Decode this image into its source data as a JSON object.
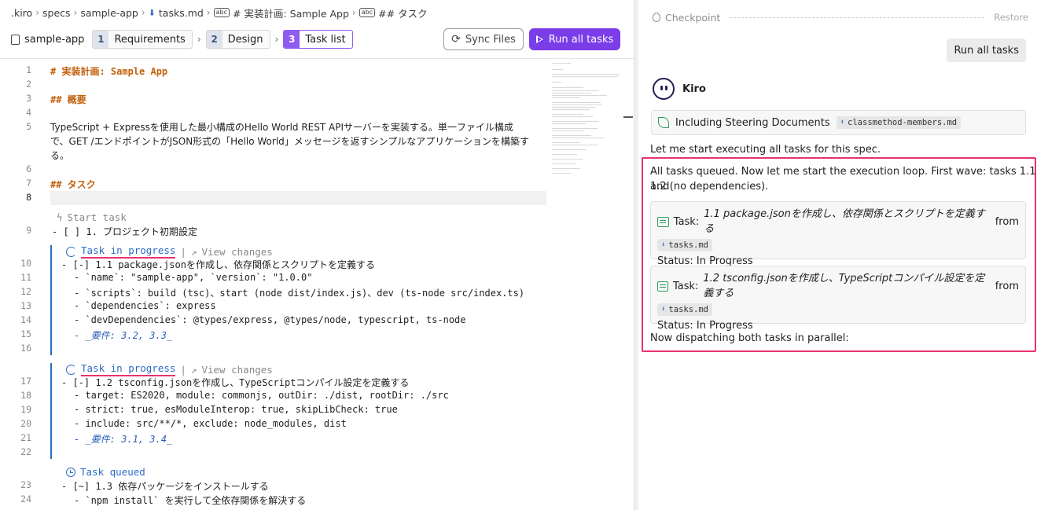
{
  "breadcrumb": {
    "items": [
      ".kiro",
      "specs",
      "sample-app",
      "tasks.md",
      "# 実装計画: Sample App",
      "## タスク"
    ]
  },
  "specbar": {
    "root": "sample-app",
    "steps": [
      {
        "num": "1",
        "label": "Requirements"
      },
      {
        "num": "2",
        "label": "Design"
      },
      {
        "num": "3",
        "label": "Task list"
      }
    ],
    "sync_label": "Sync Files",
    "run_label": "Run all tasks"
  },
  "editor": {
    "line_numbers": [
      "1",
      "2",
      "3",
      "4",
      "5",
      "6",
      "7",
      "8",
      "9",
      "10",
      "11",
      "12",
      "13",
      "14",
      "15",
      "16",
      "17",
      "18",
      "19",
      "20",
      "21",
      "22",
      "23",
      "24"
    ],
    "l1": "# 実装計画: Sample App",
    "l3": "## 概要",
    "l5a": "TypeScript + Expressを使用した最小構成のHello World REST APIサーバーを実装する。単一ファイル構成",
    "l5b": "で、GET /エンドポイントがJSON形式の「Hello World」メッセージを返すシンプルなアプリケーションを構築す",
    "l5c": "る。",
    "l7": "## タスク",
    "lens_start": "Start task",
    "l9": "- [ ] 1. プロジェクト初期設定",
    "lens1_status": "Task in progress",
    "lens1_changes": "View changes",
    "l10": "- [-] 1.1 package.jsonを作成し、依存関係とスクリプトを定義する",
    "l11": "- `name`: \"sample-app\", `version`: \"1.0.0\"",
    "l12": "- `scripts`: build (tsc)、start (node dist/index.js)、dev (ts-node src/index.ts)",
    "l13": "- `dependencies`: express",
    "l14": "- `devDependencies`: @types/express, @types/node, typescript, ts-node",
    "l15": "- _要件: 3.2, 3.3_",
    "lens2_status": "Task in progress",
    "lens2_changes": "View changes",
    "l17": "- [-] 1.2 tsconfig.jsonを作成し、TypeScriptコンパイル設定を定義する",
    "l18": "- target: ES2020, module: commonjs, outDir: ./dist, rootDir: ./src",
    "l19": "- strict: true, esModuleInterop: true, skipLibCheck: true",
    "l20": "- include: src/**/*, exclude: node_modules, dist",
    "l21": "- _要件: 3.1, 3.4_",
    "lens3_status": "Task queued",
    "l23": "- [~] 1.3 依存パッケージをインストールする",
    "l24": "- `npm install` を実行して全依存関係を解決する"
  },
  "chat": {
    "checkpoint_label": "Checkpoint",
    "restore_label": "Restore",
    "user_message": "Run all tasks",
    "agent_name": "Kiro",
    "steering_label": "Including Steering Documents",
    "steering_file": "classmethod-members.md",
    "msg1": "Let me start executing all tasks for this spec.",
    "msg2a": "All tasks queued. Now let me start the execution loop. First wave: tasks 1.1 and",
    "msg2b": "1.2 (no dependencies).",
    "tasks": [
      {
        "prefix": "Task:",
        "name": "1.1 package.jsonを作成し、依存関係とスクリプトを定義する",
        "from": "from",
        "file": "tasks.md",
        "status": "Status: In Progress"
      },
      {
        "prefix": "Task:",
        "name": "1.2 tsconfig.jsonを作成し、TypeScriptコンパイル設定を定義する",
        "from": "from",
        "file": "tasks.md",
        "status": "Status: In Progress"
      }
    ],
    "msg3": "Now dispatching both tasks in parallel:"
  },
  "colors": {
    "accent": "#7a3de8",
    "highlight": "#e8336e",
    "link": "#2b6bc6",
    "heading": "#c2610c"
  }
}
